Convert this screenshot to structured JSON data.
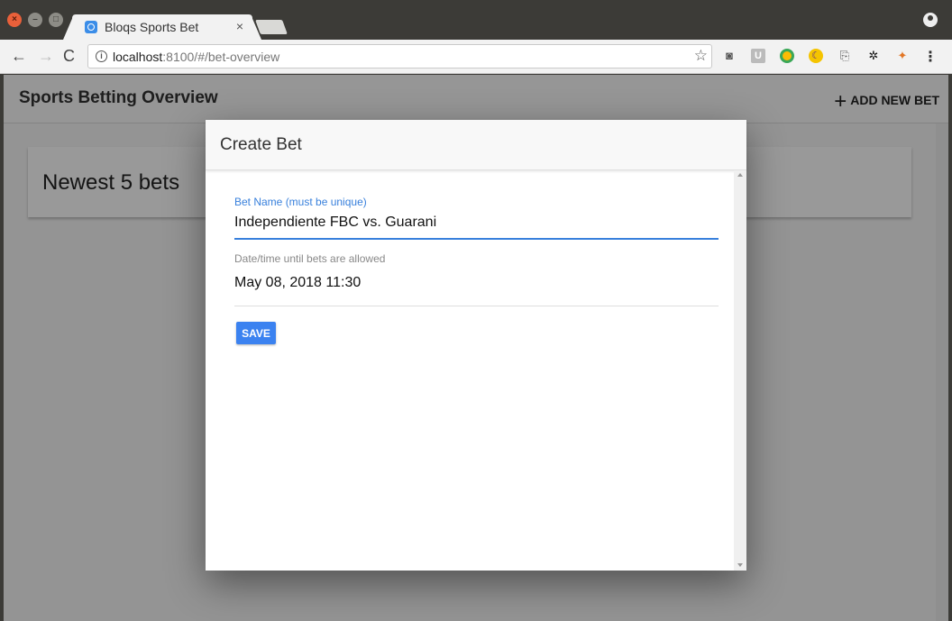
{
  "browser": {
    "tab_title": "Bloqs Sports Bet",
    "tab_close": "×",
    "url_host": "localhost",
    "url_rest": ":8100/#/bet-overview",
    "nav": {
      "back": "←",
      "forward": "→",
      "reload": "C"
    },
    "extensions": [
      "camera-icon",
      "u-extension-icon",
      "colorful-circle-icon",
      "moon-icon",
      "card-icon",
      "paw-icon",
      "fox-icon"
    ]
  },
  "app": {
    "title": "Sports Betting Overview",
    "add_new_label": "ADD NEW BET",
    "card_title": "Newest 5 bets"
  },
  "modal": {
    "title": "Create Bet",
    "bet_name_label": "Bet Name (must be unique)",
    "bet_name_value": "Independiente FBC vs. Guarani",
    "deadline_label": "Date/time until bets are allowed",
    "deadline_value": "May 08, 2018 11:30",
    "save_label": "SAVE"
  },
  "colors": {
    "accent": "#3880dc",
    "button": "#3b82f0"
  }
}
